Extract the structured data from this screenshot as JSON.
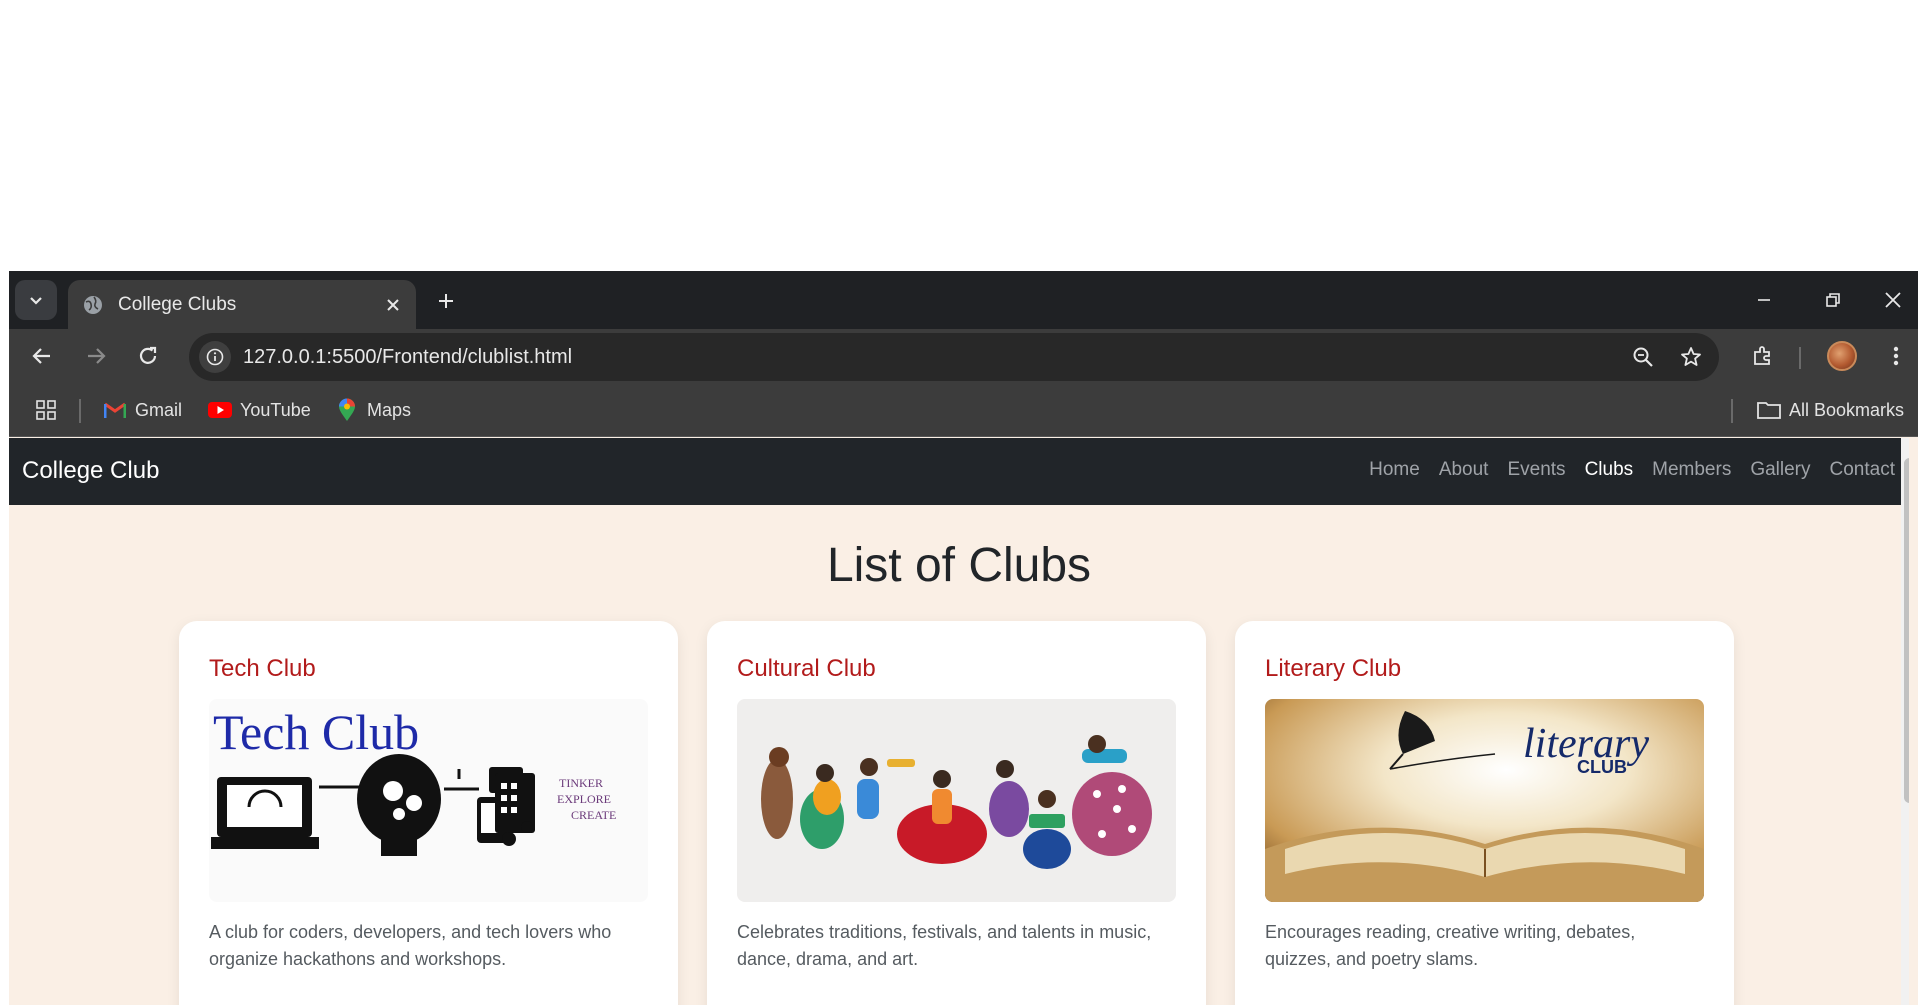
{
  "browser": {
    "tab_title": "College Clubs",
    "url": "127.0.0.1:5500/Frontend/clublist.html",
    "bookmarks": [
      {
        "label": "Gmail",
        "icon": "gmail-icon"
      },
      {
        "label": "YouTube",
        "icon": "youtube-icon"
      },
      {
        "label": "Maps",
        "icon": "maps-icon"
      }
    ],
    "all_bookmarks_label": "All Bookmarks"
  },
  "site": {
    "brand": "College Club",
    "nav": [
      "Home",
      "About",
      "Events",
      "Clubs",
      "Members",
      "Gallery",
      "Contact"
    ],
    "active_nav": "Clubs",
    "heading": "List of Clubs"
  },
  "clubs": [
    {
      "title": "Tech Club",
      "image_text": "Tech Club",
      "image_tagline": [
        "TINKER",
        "EXPLORE",
        "CREATE"
      ],
      "description": "A club for coders, developers, and tech lovers who organize hackathons and workshops."
    },
    {
      "title": "Cultural Club",
      "description": "Celebrates traditions, festivals, and talents in music, dance, drama, and art."
    },
    {
      "title": "Literary Club",
      "image_text": "literary",
      "image_subtext": "CLUB",
      "description": "Encourages reading, creative writing, debates, quizzes, and poetry slams."
    }
  ],
  "colors": {
    "navbar_bg": "#212529",
    "page_bg": "#faefe5",
    "club_title": "#b21b1b"
  }
}
